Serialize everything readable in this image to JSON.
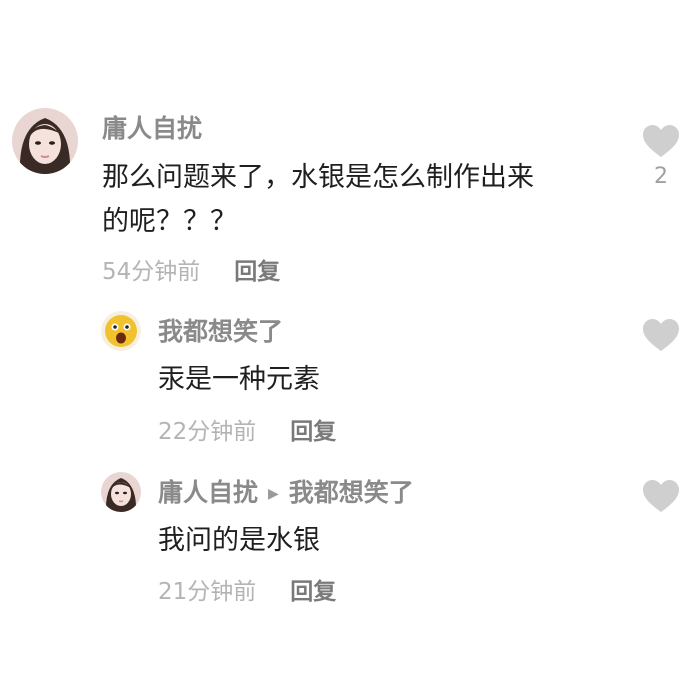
{
  "comments": [
    {
      "username": "庸人自扰",
      "text_line1": "那么问题来了，水银是怎么制作出来",
      "text_line2": "的呢？？？",
      "time": "54分钟前",
      "reply_label": "回复",
      "like_count": "2",
      "like_icon": "heart-icon",
      "avatar": "woman-portrait"
    },
    {
      "username": "我都想笑了",
      "text": "汞是一种元素",
      "time": "22分钟前",
      "reply_label": "回复",
      "like_icon": "heart-icon",
      "avatar": "yellow-cartoon"
    },
    {
      "username": "庸人自扰",
      "reply_arrow": "▶",
      "reply_to": "我都想笑了",
      "text": "我问的是水银",
      "time": "21分钟前",
      "reply_label": "回复",
      "like_icon": "heart-icon",
      "avatar": "woman-portrait"
    }
  ],
  "colors": {
    "username": "#8a8a8a",
    "text": "#1f1f1f",
    "time": "#b4b4b4",
    "heart": "#cfcfcf"
  }
}
